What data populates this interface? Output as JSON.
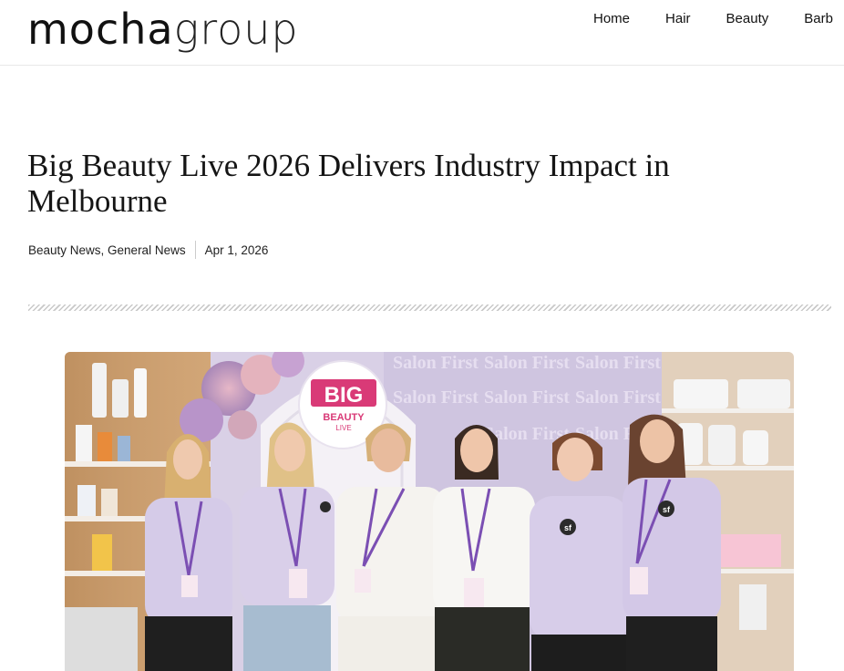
{
  "header": {
    "logo_bold": "mocha",
    "logo_light": "group",
    "nav": [
      {
        "label": "Home"
      },
      {
        "label": "Hair"
      },
      {
        "label": "Beauty"
      },
      {
        "label": "Barb"
      }
    ]
  },
  "article": {
    "title": "Big Beauty Live 2026 Delivers Industry Impact in Melbourne",
    "categories": "Beauty News, General News",
    "date": "Apr 1, 2026"
  },
  "hero": {
    "sign_big": "BIG",
    "sign_sub1": "BEAUTY",
    "sign_sub2": "LIVE",
    "backdrop_text": "Salon First",
    "shirt_logo": "sf"
  }
}
